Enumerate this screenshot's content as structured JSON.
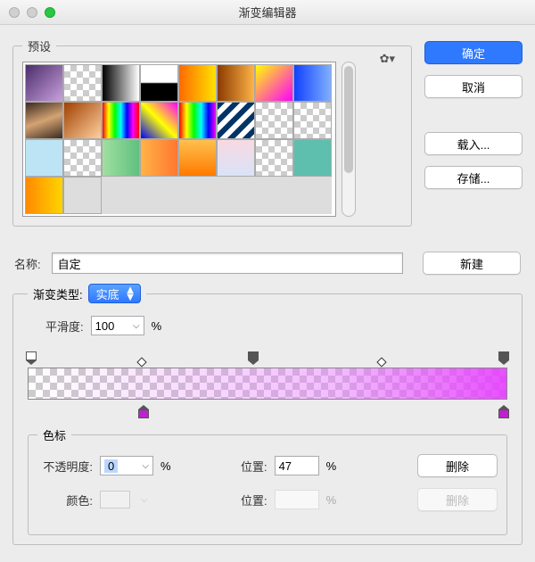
{
  "window": {
    "title": "渐变编辑器"
  },
  "presets": {
    "legend": "预设"
  },
  "buttons": {
    "ok": "确定",
    "cancel": "取消",
    "load": "载入...",
    "save": "存储...",
    "new": "新建",
    "delete": "删除",
    "delete2": "删除"
  },
  "name": {
    "label": "名称:",
    "value": "自定"
  },
  "gradientType": {
    "label": "渐变类型:",
    "value": "实底",
    "smoothness_label": "平滑度:",
    "smoothness_value": "100",
    "percent": "%"
  },
  "gradient": {
    "opacityStops": [
      {
        "pos": 0
      },
      {
        "pos": 47
      },
      {
        "pos": 100
      }
    ],
    "midpoints": [
      {
        "pos": 24
      },
      {
        "pos": 74
      }
    ],
    "colorStops": [
      {
        "pos": 24,
        "color": "#c020d0"
      },
      {
        "pos": 99,
        "color": "#c020d0"
      }
    ]
  },
  "stops": {
    "legend": "色标",
    "opacity_label": "不透明度:",
    "opacity_value": "0",
    "opacity_pct": "%",
    "location_label": "位置:",
    "location_value": "47",
    "location_pct": "%",
    "color_label": "颜色:",
    "location2_label": "位置:",
    "location2_value": "",
    "location2_pct": "%"
  },
  "chart_data": {
    "type": "gradient",
    "opacity_stops": [
      {
        "position": 0,
        "opacity": 0
      },
      {
        "position": 47,
        "opacity": 0
      },
      {
        "position": 100,
        "opacity": 100
      }
    ],
    "color_stops": [
      {
        "position": 24,
        "color": "#c020d0"
      },
      {
        "position": 99,
        "color": "#c020d0"
      }
    ]
  }
}
